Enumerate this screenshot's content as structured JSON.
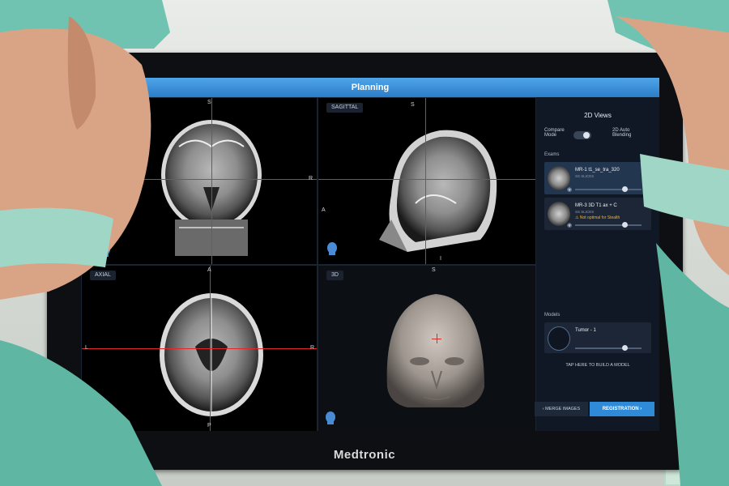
{
  "app": {
    "title": "Planning",
    "brand": "Medtronic"
  },
  "viewports": {
    "coronal": {
      "orientation": {
        "top": "S",
        "right": "R",
        "left": "",
        "bottom": ""
      }
    },
    "sagittal": {
      "label": "SAGITTAL",
      "orientation": {
        "top": "S",
        "left": "A",
        "right": "",
        "bottom": "I"
      }
    },
    "axial": {
      "label": "AXIAL",
      "orientation": {
        "top": "A",
        "left": "L",
        "right": "R",
        "bottom": "P"
      }
    },
    "threeD": {
      "label": "3D",
      "orientation": {
        "top": "S",
        "left": "",
        "right": "",
        "bottom": ""
      }
    }
  },
  "side_panel": {
    "title": "2D Views",
    "compare_mode": "Compare Mode",
    "auto_blending": "2D Auto Blending",
    "exams_label": "Exams",
    "exams": [
      {
        "title": "MR-1 t1_se_tra_320",
        "sub": "SS SLICES"
      },
      {
        "title": "MR-3 3D T1 ax + C",
        "sub": "SS SLICES",
        "warning": "Not optimal for Stealth"
      }
    ],
    "models_label": "Models",
    "model": {
      "title": "Tumor - 1"
    },
    "build_model": "TAP HERE TO BUILD A MODEL",
    "merge_button": "MERGE IMAGES",
    "registration_button": "REGISTRATION"
  },
  "colors": {
    "title_bar": "#2c7dc8",
    "crosshair": "#e02a2a",
    "registration": "#2f8ad8",
    "scrubs": "#6fc3b0"
  }
}
